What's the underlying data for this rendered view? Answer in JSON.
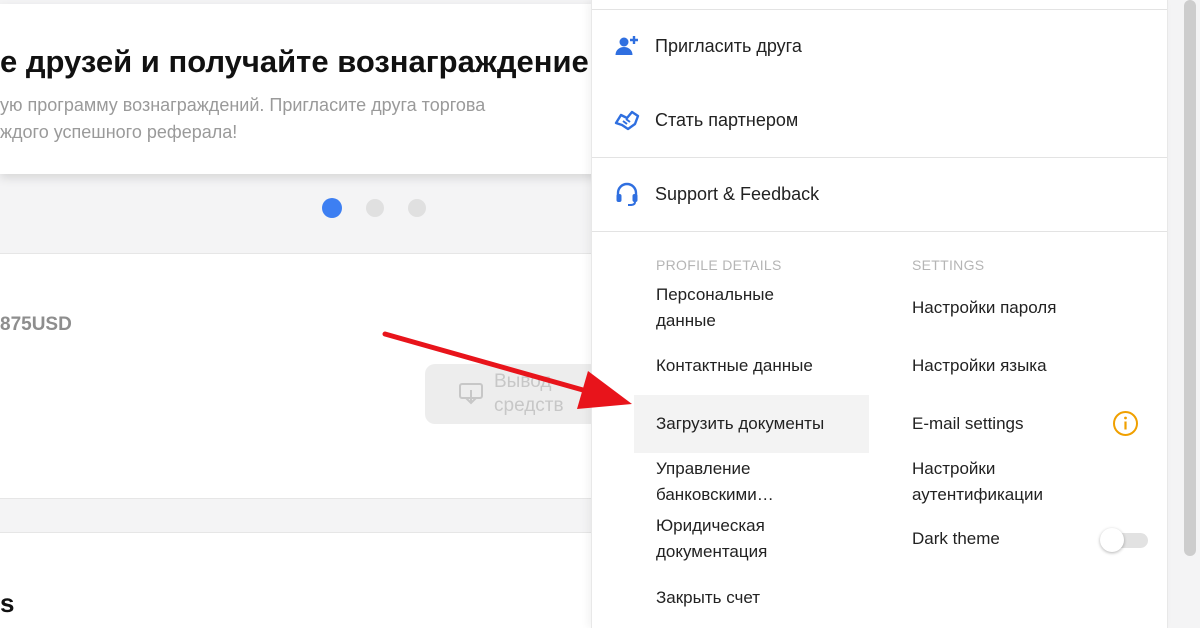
{
  "promo": {
    "title": "е друзей и получайте вознаграждение!",
    "text_line1": "ую программу вознаграждений. Пригласите друга торгова",
    "text_line2": "ждого успешного реферала!"
  },
  "balance": {
    "amount": "875USD",
    "withdraw_label": "Вывод средств",
    "withdraw_icon": "withdraw-icon"
  },
  "bottom": {
    "heading": "s"
  },
  "menu": {
    "items": [
      {
        "label": "Пригласить друга",
        "icon": "add-user-icon"
      },
      {
        "label": "Стать партнером",
        "icon": "partner-handshake-icon"
      },
      {
        "label": "Support & Feedback",
        "icon": "headset-icon"
      }
    ]
  },
  "profile_details": {
    "title": "PROFILE DETAILS",
    "items": [
      "Персональные данные",
      "Контактные данные",
      "Загрузить документы",
      "Управление банковскими…",
      "Юридическая документация",
      "Закрыть счет"
    ]
  },
  "settings": {
    "title": "SETTINGS",
    "items": [
      "Настройки пароля",
      "Настройки языка",
      "E-mail settings",
      "Настройки аутентификации",
      "Dark theme"
    ],
    "dark_theme_enabled": false,
    "email_info_icon": "info-icon"
  },
  "colors": {
    "accent_blue": "#3d7ff2",
    "warning_orange": "#f0a000",
    "annotation_red": "#e8141b"
  },
  "carousel": {
    "pages": 3,
    "active_index": 0
  }
}
